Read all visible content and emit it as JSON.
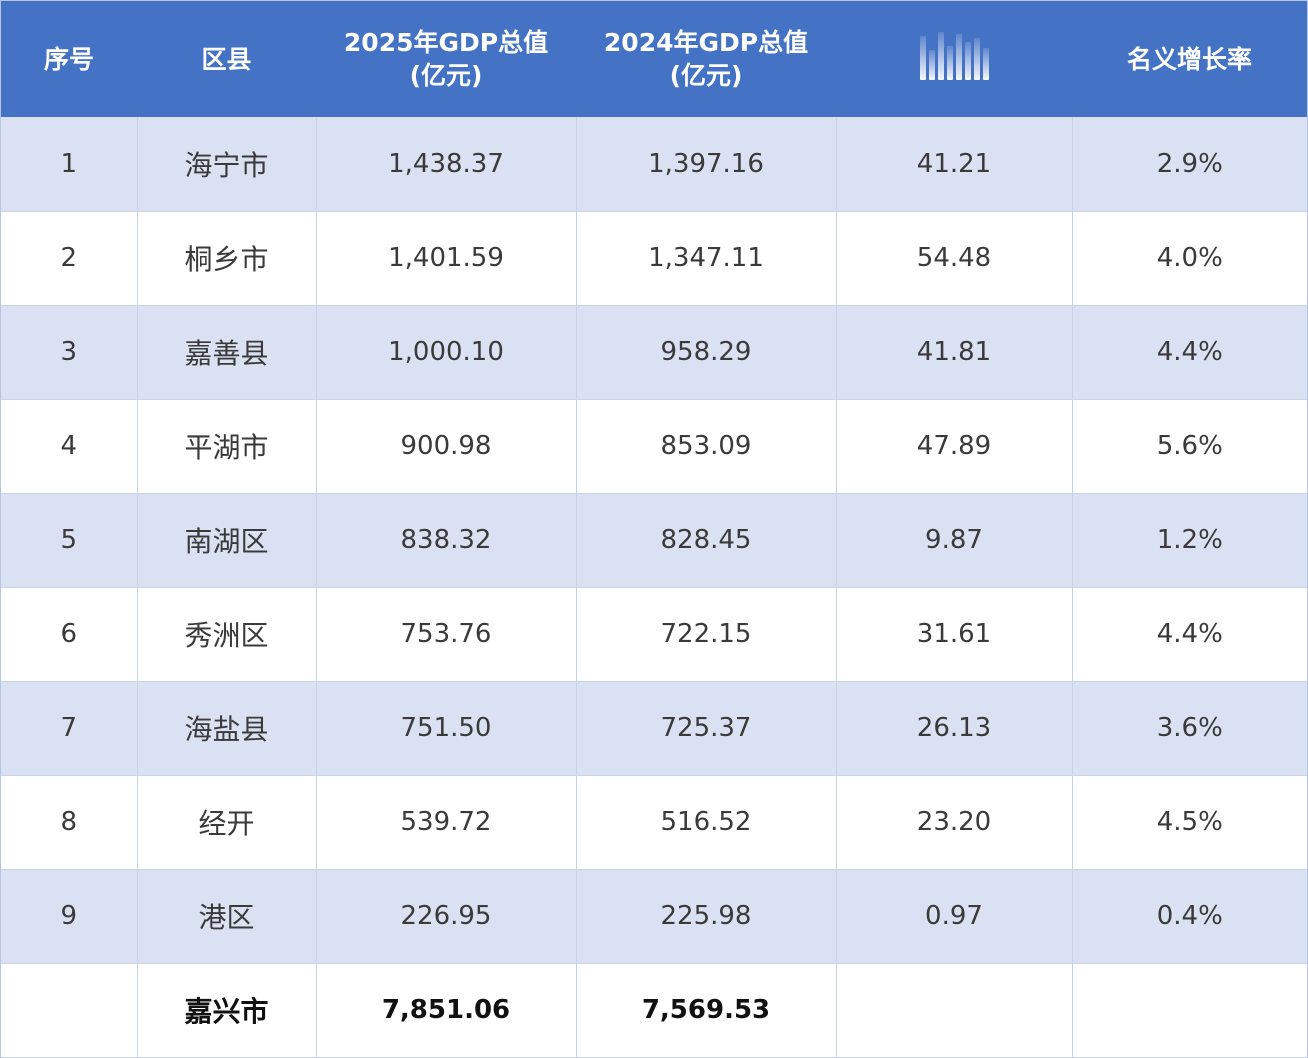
{
  "header": {
    "col0": "序号",
    "col1": "区县",
    "col2_line1": "2025年GDP总值",
    "col2_line2": "(亿元)",
    "col3_line1": "2024年GDP总值",
    "col3_line2": "(亿元)",
    "col4_icon": "vertical-bars-icon",
    "col5": "名义增长率"
  },
  "rows": [
    {
      "no": "1",
      "county": "海宁市",
      "gdp2025": "1,438.37",
      "gdp2024": "1,397.16",
      "diff": "41.21",
      "growth": "2.9%"
    },
    {
      "no": "2",
      "county": "桐乡市",
      "gdp2025": "1,401.59",
      "gdp2024": "1,347.11",
      "diff": "54.48",
      "growth": "4.0%"
    },
    {
      "no": "3",
      "county": "嘉善县",
      "gdp2025": "1,000.10",
      "gdp2024": "958.29",
      "diff": "41.81",
      "growth": "4.4%"
    },
    {
      "no": "4",
      "county": "平湖市",
      "gdp2025": "900.98",
      "gdp2024": "853.09",
      "diff": "47.89",
      "growth": "5.6%"
    },
    {
      "no": "5",
      "county": "南湖区",
      "gdp2025": "838.32",
      "gdp2024": "828.45",
      "diff": "9.87",
      "growth": "1.2%"
    },
    {
      "no": "6",
      "county": "秀洲区",
      "gdp2025": "753.76",
      "gdp2024": "722.15",
      "diff": "31.61",
      "growth": "4.4%"
    },
    {
      "no": "7",
      "county": "海盐县",
      "gdp2025": "751.50",
      "gdp2024": "725.37",
      "diff": "26.13",
      "growth": "3.6%"
    },
    {
      "no": "8",
      "county": "经开",
      "gdp2025": "539.72",
      "gdp2024": "516.52",
      "diff": "23.20",
      "growth": "4.5%"
    },
    {
      "no": "9",
      "county": "港区",
      "gdp2025": "226.95",
      "gdp2024": "225.98",
      "diff": "0.97",
      "growth": "0.4%"
    }
  ],
  "total": {
    "no": "",
    "county": "嘉兴市",
    "gdp2025": "7,851.06",
    "gdp2024": "7,569.53",
    "diff": "",
    "growth": ""
  },
  "colors": {
    "header_bg": "#4472c4",
    "header_text": "#ffffff",
    "band": "#d9e1f2",
    "plain": "#ffffff",
    "grid": "#c9d3e6"
  }
}
